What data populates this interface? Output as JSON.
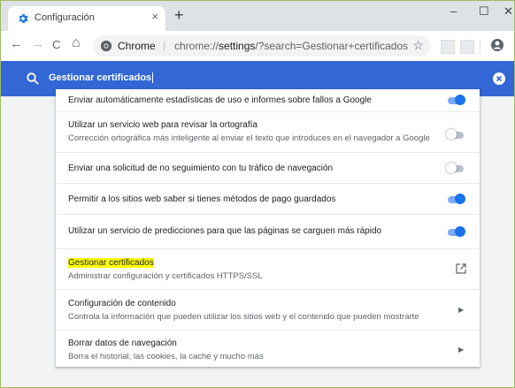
{
  "tab": {
    "title": "Configuración",
    "close": "×",
    "new_tab": "+"
  },
  "window_controls": {
    "minimize": "–",
    "maximize": "☐",
    "close": "✕"
  },
  "omnibox": {
    "chrome_label": "Chrome",
    "separator": "|",
    "url_prefix": "chrome://",
    "url_path": "settings",
    "url_query": "/?search=Gestionar+certificados"
  },
  "search": {
    "query": "Gestionar certificados"
  },
  "settings": [
    {
      "title": "Enviar automáticamente estadísticas de uso e informes sobre fallos a Google",
      "control": "toggle",
      "state": "on"
    },
    {
      "title": "Utilizar un servicio web para revisar la ortografía",
      "subtitle": "Corrección ortográfica más inteligente al enviar el texto que introduces en el navegador a Google",
      "control": "toggle",
      "state": "off"
    },
    {
      "title": "Enviar una solicitud de no seguimiento con tu tráfico de navegación",
      "control": "toggle",
      "state": "off"
    },
    {
      "title": "Permitir a los sitios web saber si tienes métodos de pago guardados",
      "control": "toggle",
      "state": "on"
    },
    {
      "title": "Utilizar un servicio de predicciones para que las páginas se carguen más rápido",
      "control": "toggle",
      "state": "on"
    },
    {
      "title": "Gestionar certificados",
      "subtitle": "Administrar configuración y certificados HTTPS/SSL",
      "control": "external-link",
      "highlighted": true
    },
    {
      "title": "Configuración de contenido",
      "subtitle": "Controla la información que pueden utilizar los sitios web y el contenido que pueden mostrarte",
      "control": "arrow"
    },
    {
      "title": "Borrar datos de navegación",
      "subtitle": "Borra el historial, las cookies, la caché y mucho más",
      "control": "arrow"
    }
  ],
  "glyphs": {
    "back": "←",
    "forward": "→",
    "reload": "C",
    "home": "⌂",
    "star": "☆",
    "kebab": "⋮",
    "arrow": "▶"
  },
  "colors": {
    "accent": "#1a73e8",
    "search_bar": "#3367d6",
    "highlight": "#ffff00",
    "gear": "#1a73e8"
  }
}
